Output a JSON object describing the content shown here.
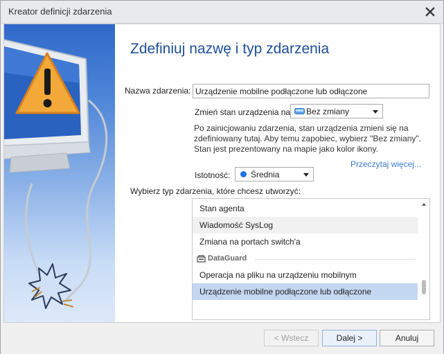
{
  "window": {
    "title": "Kreator definicji zdarzenia"
  },
  "page": {
    "heading": "Zdefiniuj nazwę i typ zdarzenia"
  },
  "form": {
    "name_label": "Nazwa zdarzenia:",
    "name_value": "Urządzenie mobilne podłączone lub odłączone",
    "state_label": "Zmień stan urządzenia na:",
    "state_value": "Bez zmiany",
    "info_lines": [
      "Po zainicjowaniu zdarzenia, stan urządzenia zmieni się na",
      "zdefiniowany tutaj. Aby temu zapobiec, wybierz \"Bez zmiany\".",
      "Stan jest prezentowany na mapie jako kolor ikony."
    ],
    "read_more": "Przeczytaj więcej...",
    "importance_label": "Istotność:",
    "importance_value": "Średnia",
    "importance_color": "#1e73e8",
    "type_label": "Wybierz typ zdarzenia, które chcesz utworzyć:"
  },
  "event_types": {
    "items_top": [
      "Stan agenta",
      "Wiadomość SysLog",
      "Zmiana na portach switch'a"
    ],
    "group_name": "DataGuard",
    "items_group": [
      "Operacja na pliku na urządzeniu mobilnym",
      "Urządzenie mobilne podłączone lub odłączone"
    ]
  },
  "buttons": {
    "back": "< Wstecz",
    "next": "Dalej >",
    "cancel": "Anuluj"
  }
}
